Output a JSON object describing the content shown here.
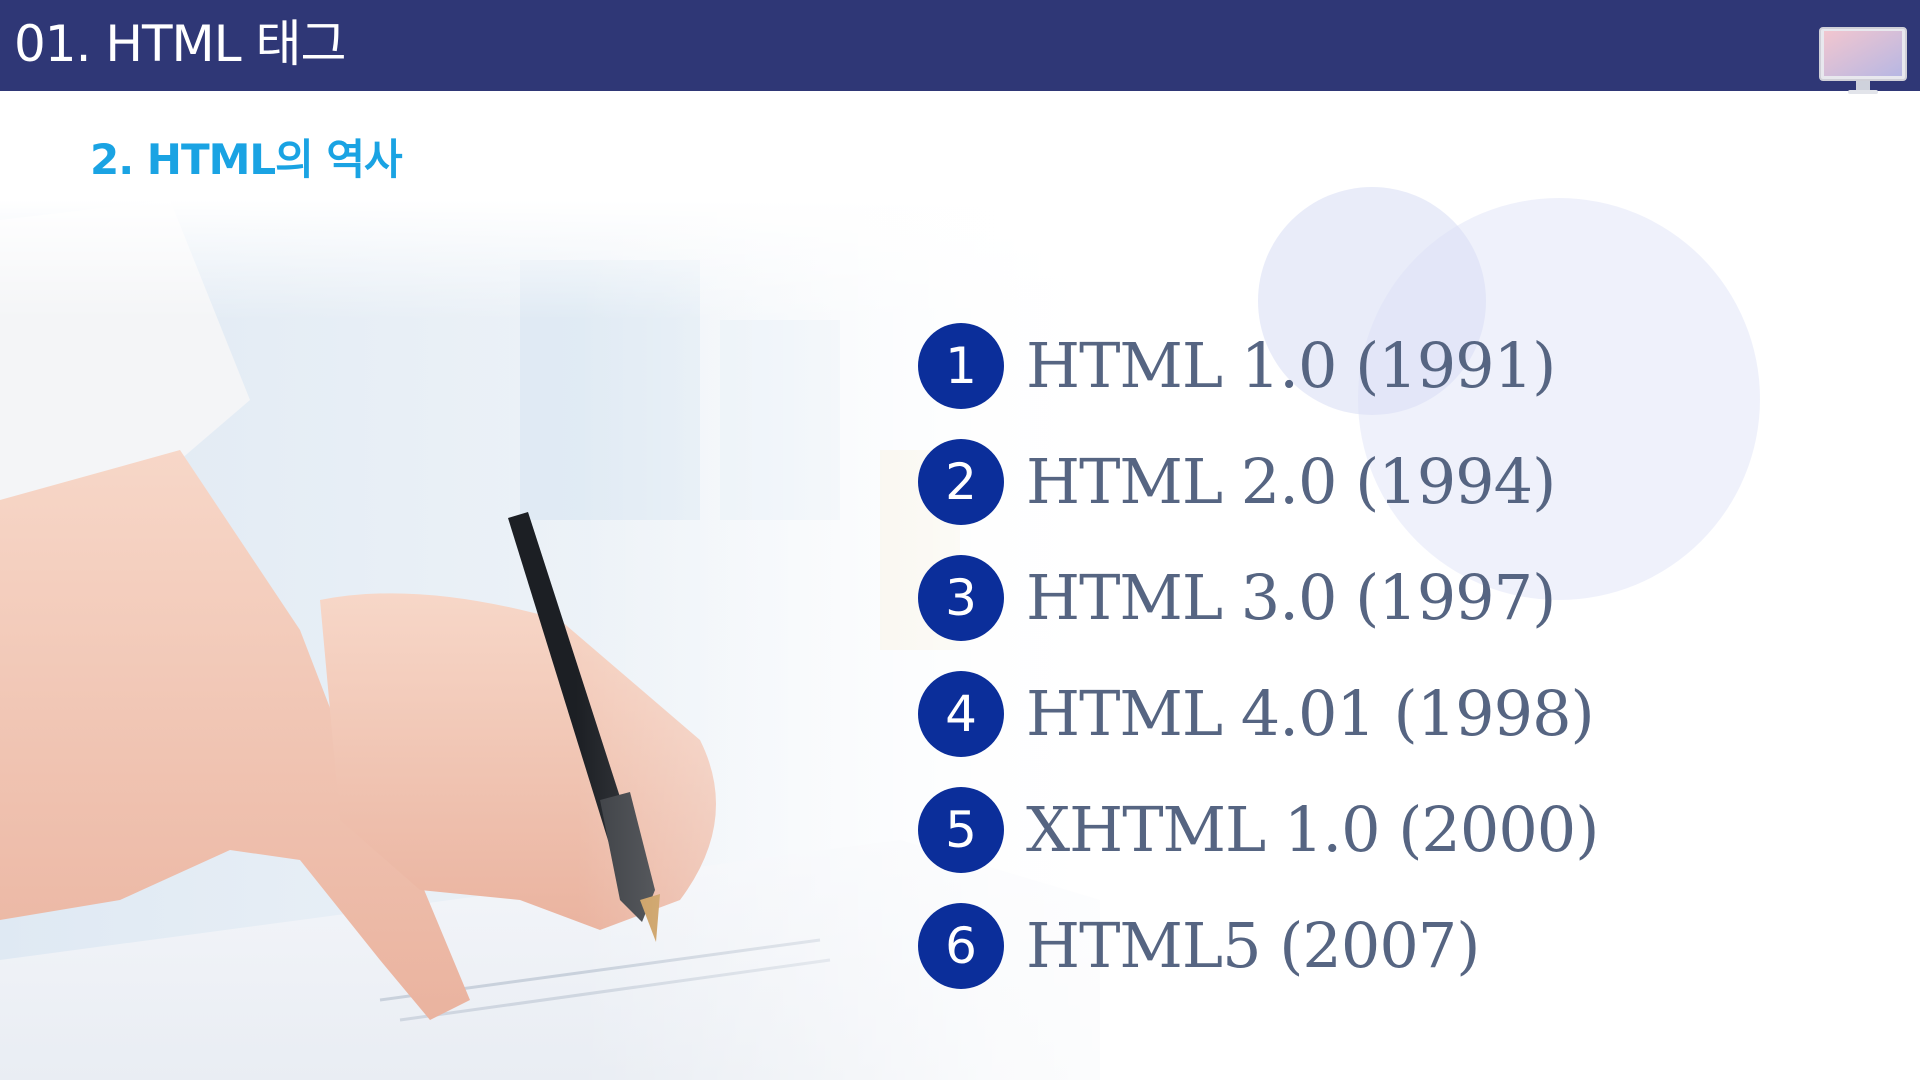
{
  "header": {
    "title": "01. HTML 태그"
  },
  "icons": {
    "monitor": "monitor-icon"
  },
  "subtitle": "2. HTML의 역사",
  "list": {
    "items": [
      {
        "number": "1",
        "text": "HTML 1.0 (1991)"
      },
      {
        "number": "2",
        "text": "HTML 2.0 (1994)"
      },
      {
        "number": "3",
        "text": "HTML 3.0 (1997)"
      },
      {
        "number": "4",
        "text": "HTML 4.01 (1998)"
      },
      {
        "number": "5",
        "text": "XHTML 1.0 (2000)"
      },
      {
        "number": "6",
        "text": "HTML5 (2007)"
      }
    ]
  },
  "colors": {
    "header_bg": "#2f3776",
    "subtitle": "#1aa3e3",
    "badge": "#0b2e9a",
    "item_text": "#566582"
  }
}
